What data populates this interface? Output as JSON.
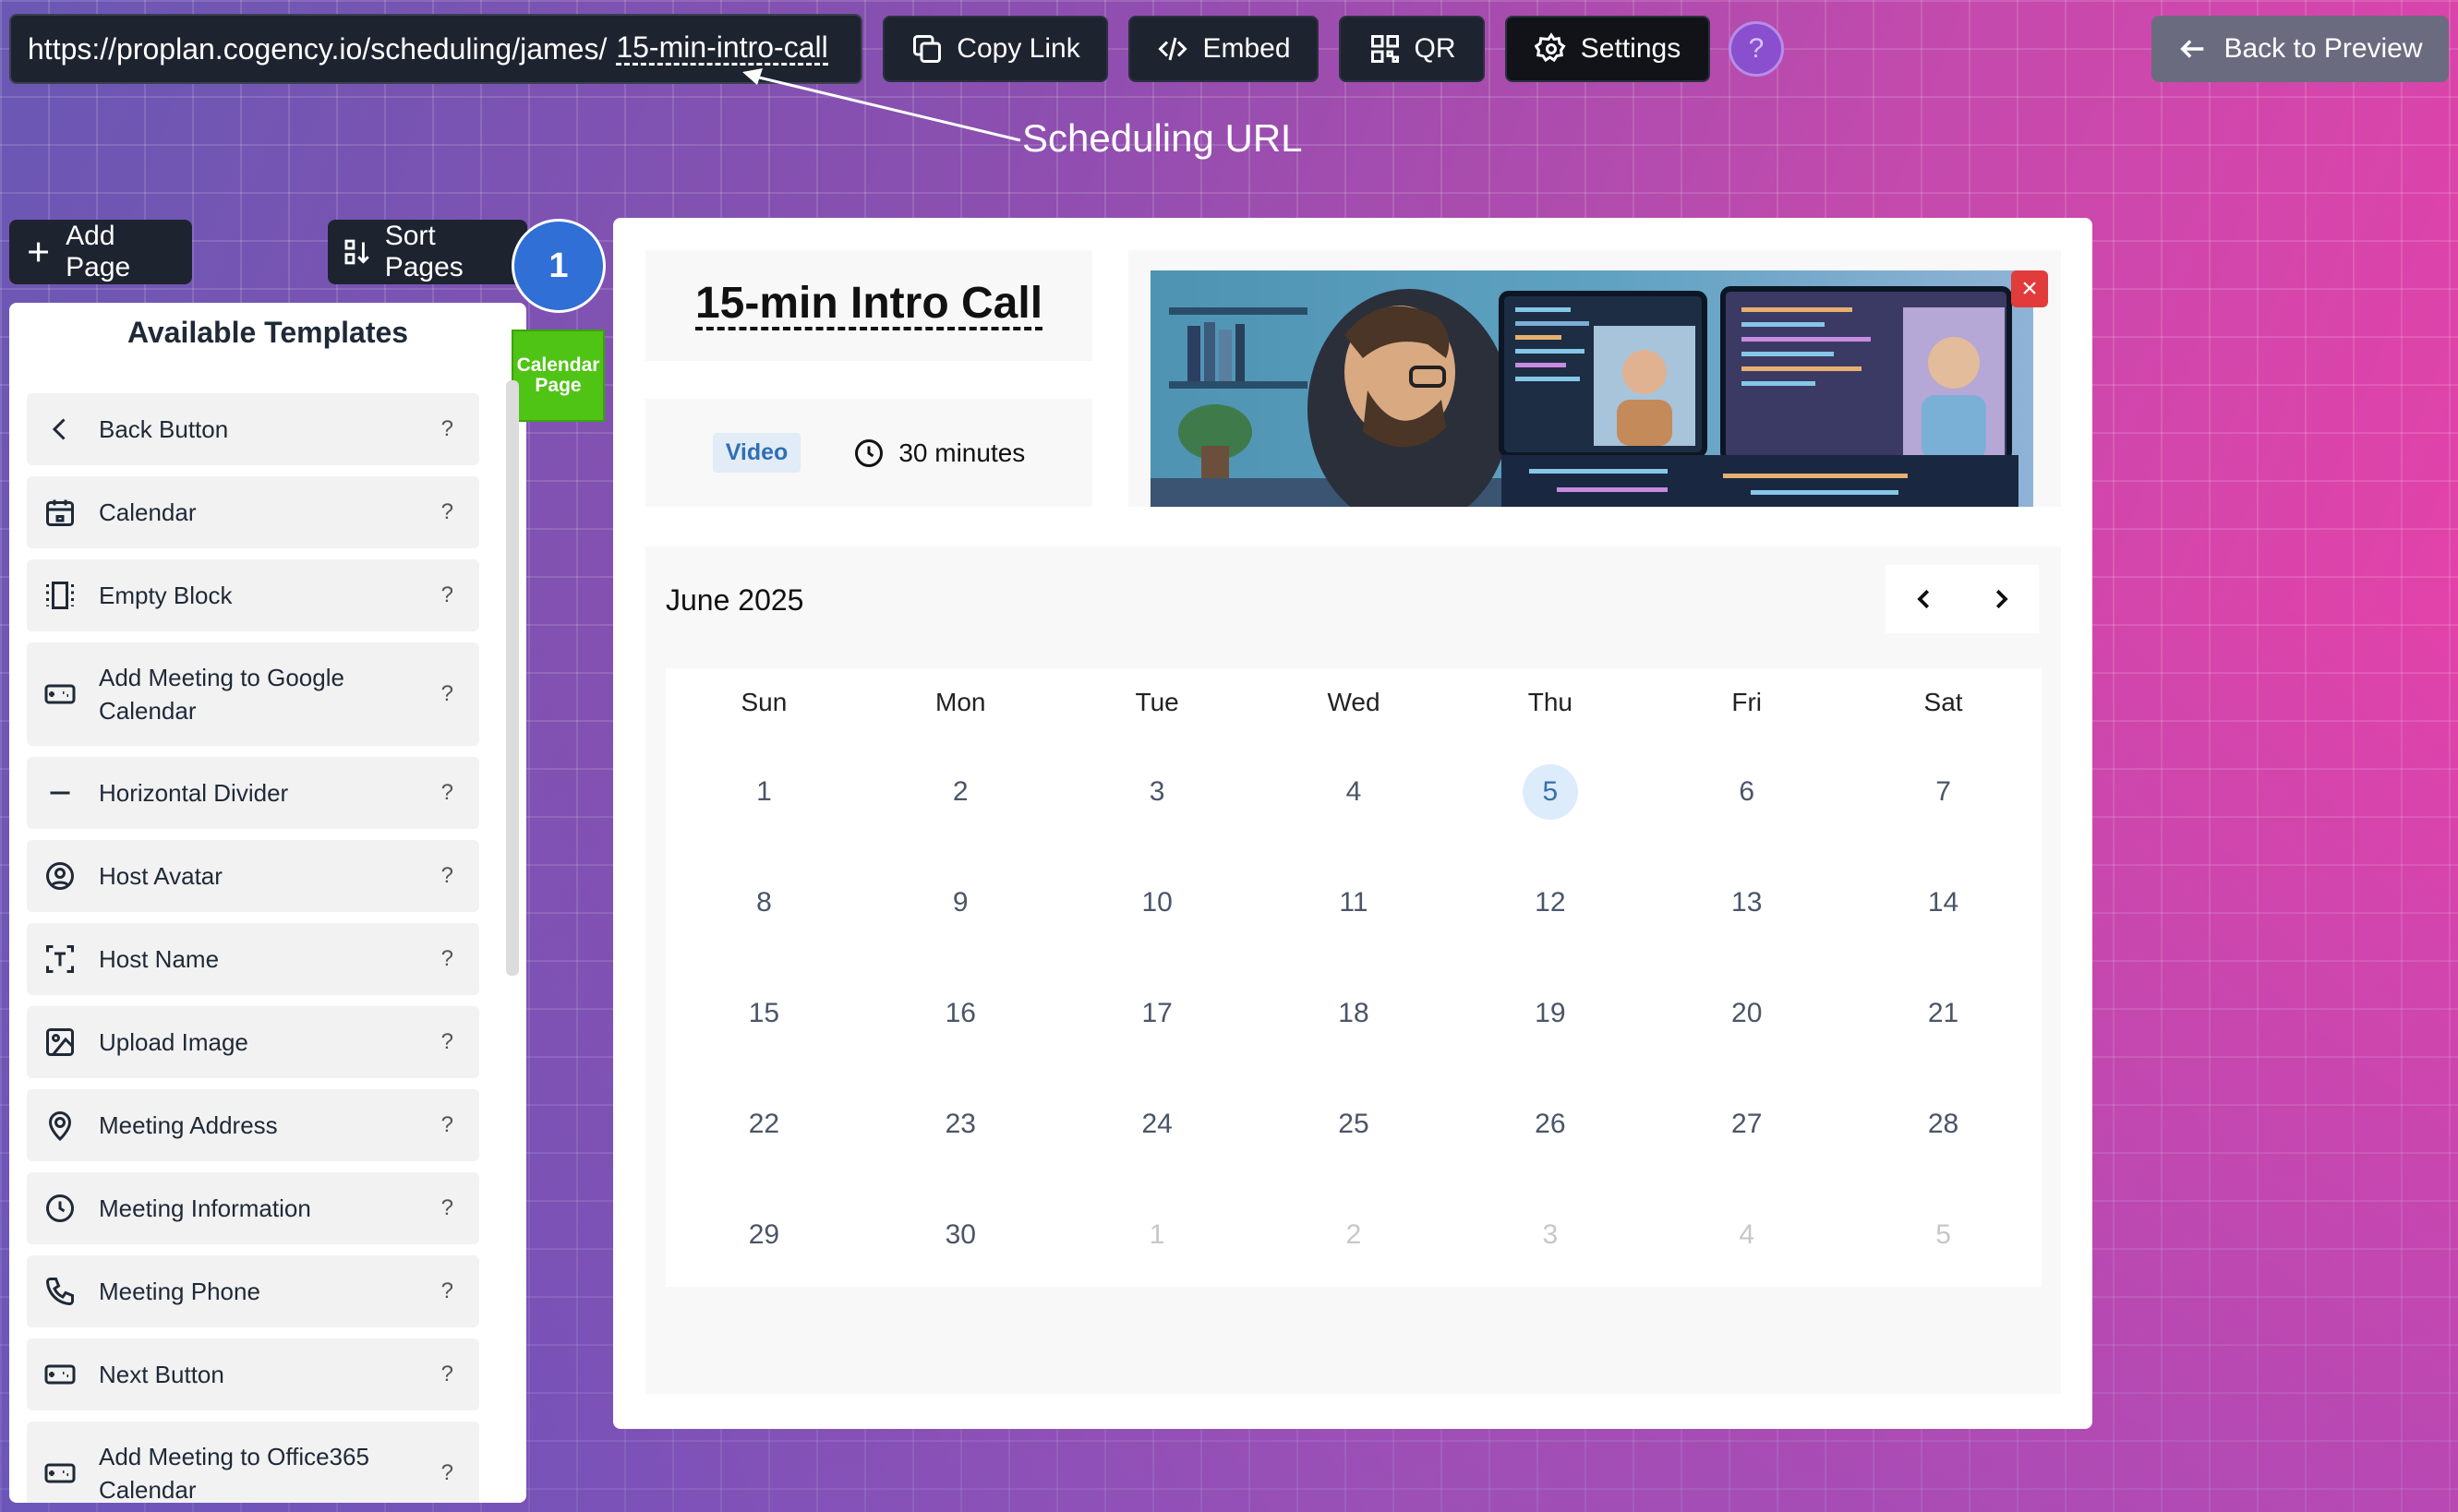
{
  "topbar": {
    "url_base": "https://proplan.cogency.io/scheduling/james/",
    "url_slug": "15-min-intro-call",
    "copy_link": "Copy Link",
    "embed": "Embed",
    "qr": "QR",
    "settings": "Settings",
    "help": "?",
    "back_to_preview": "Back to Preview",
    "annotation": "Scheduling URL"
  },
  "sidebar": {
    "add_page": "Add Page",
    "sort_pages": "Sort Pages",
    "page_number": "1",
    "page_tab": "Calendar Page",
    "templates_title": "Available Templates",
    "templates": [
      {
        "label": "Back Button",
        "icon": "chevron-left-icon"
      },
      {
        "label": "Calendar",
        "icon": "calendar-icon"
      },
      {
        "label": "Empty Block",
        "icon": "empty-block-icon"
      },
      {
        "label": "Add Meeting to Google Calendar",
        "icon": "ticket-icon"
      },
      {
        "label": "Horizontal Divider",
        "icon": "divider-icon"
      },
      {
        "label": "Host Avatar",
        "icon": "user-circle-icon"
      },
      {
        "label": "Host Name",
        "icon": "text-frame-icon"
      },
      {
        "label": "Upload Image",
        "icon": "image-icon"
      },
      {
        "label": "Meeting Address",
        "icon": "map-pin-icon"
      },
      {
        "label": "Meeting Information",
        "icon": "clock-icon"
      },
      {
        "label": "Meeting Phone",
        "icon": "phone-icon"
      },
      {
        "label": "Next Button",
        "icon": "ticket-icon"
      },
      {
        "label": "Add Meeting to Office365 Calendar",
        "icon": "ticket-icon"
      }
    ],
    "help_mark": "?"
  },
  "preview": {
    "title": "15-min Intro Call",
    "badge": "Video",
    "duration": "30 minutes",
    "hero_close": "×",
    "calendar": {
      "month": "June 2025",
      "weekdays": [
        "Sun",
        "Mon",
        "Tue",
        "Wed",
        "Thu",
        "Fri",
        "Sat"
      ],
      "weeks": [
        [
          "1",
          "2",
          "3",
          "4",
          "5",
          "6",
          "7"
        ],
        [
          "8",
          "9",
          "10",
          "11",
          "12",
          "13",
          "14"
        ],
        [
          "15",
          "16",
          "17",
          "18",
          "19",
          "20",
          "21"
        ],
        [
          "22",
          "23",
          "24",
          "25",
          "26",
          "27",
          "28"
        ],
        [
          "29",
          "30",
          "1",
          "2",
          "3",
          "4",
          "5"
        ]
      ],
      "today": "5"
    }
  },
  "colors": {
    "accent_blue": "#2f6fd6",
    "page_tab_green": "#4fc414",
    "close_red": "#e23b3b"
  }
}
